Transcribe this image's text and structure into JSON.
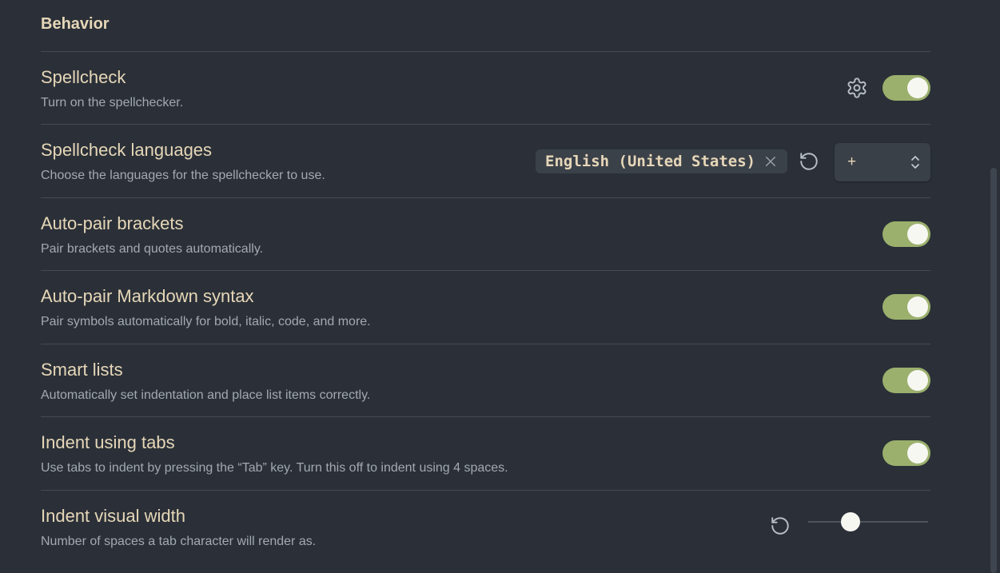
{
  "section": {
    "title": "Behavior"
  },
  "settings": [
    {
      "name": "Spellcheck",
      "description": "Turn on the spellchecker.",
      "enabled": true
    },
    {
      "name": "Spellcheck languages",
      "description": "Choose the languages for the spellchecker to use."
    },
    {
      "name": "Auto-pair brackets",
      "description": "Pair brackets and quotes automatically.",
      "enabled": true
    },
    {
      "name": "Auto-pair Markdown syntax",
      "description": "Pair symbols automatically for bold, italic, code, and more.",
      "enabled": true
    },
    {
      "name": "Smart lists",
      "description": "Automatically set indentation and place list items correctly.",
      "enabled": true
    },
    {
      "name": "Indent using tabs",
      "description": "Use tabs to indent by pressing the “Tab” key. Turn this off to indent using 4 spaces.",
      "enabled": true
    },
    {
      "name": "Indent visual width",
      "description": "Number of spaces a tab character will render as."
    }
  ],
  "languages": {
    "selected": [
      "English (United States)"
    ],
    "add_select_value": "+"
  },
  "icons": {
    "settings": "gear-icon",
    "remove": "close-icon",
    "reset": "reset-icon",
    "select_arrows": "chevron-up-down-icon"
  },
  "colors": {
    "background": "#2b3038",
    "heading_text": "#e6d7b8",
    "description_text": "#a3a9b0",
    "toggle_on": "#9bb06d",
    "divider": "#434a54"
  }
}
